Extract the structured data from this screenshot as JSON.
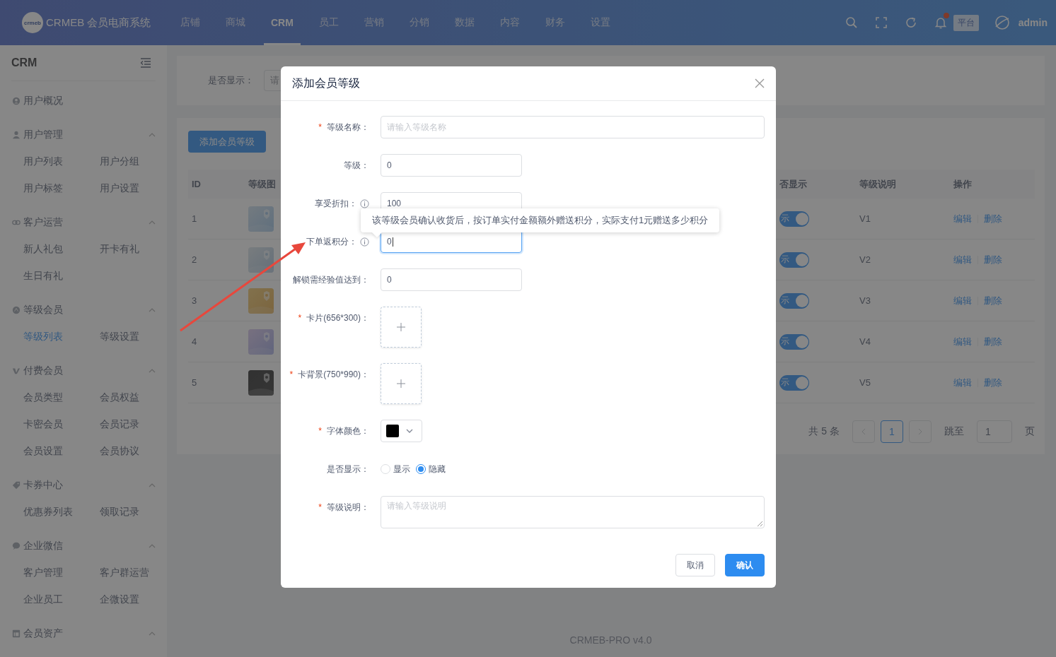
{
  "header": {
    "logo_text": "crmeb",
    "brand": "CRMEB 会员电商系统",
    "nav": [
      {
        "label": "店铺",
        "selected": false
      },
      {
        "label": "商城",
        "selected": false
      },
      {
        "label": "CRM",
        "selected": true
      },
      {
        "label": "员工",
        "selected": false
      },
      {
        "label": "营销",
        "selected": false
      },
      {
        "label": "分销",
        "selected": false
      },
      {
        "label": "数据",
        "selected": false
      },
      {
        "label": "内容",
        "selected": false
      },
      {
        "label": "财务",
        "selected": false
      },
      {
        "label": "设置",
        "selected": false
      }
    ],
    "notification_dot": true,
    "badge": "平台",
    "user": "admin"
  },
  "sidebar": {
    "title": "CRM",
    "groups": [
      {
        "label": "用户概况"
      },
      {
        "label": "用户管理",
        "expanded": true,
        "items": [
          {
            "label": "用户列表",
            "selected": false
          },
          {
            "label": "用户分组",
            "selected": false
          },
          {
            "label": "用户标签",
            "selected": false
          },
          {
            "label": "用户设置",
            "selected": false
          }
        ]
      },
      {
        "label": "客户运营",
        "expanded": true,
        "items": [
          {
            "label": "新人礼包",
            "selected": false
          },
          {
            "label": "开卡有礼",
            "selected": false
          },
          {
            "label": "生日有礼",
            "selected": false
          }
        ]
      },
      {
        "label": "等级会员",
        "expanded": true,
        "items": [
          {
            "label": "等级列表",
            "selected": true
          },
          {
            "label": "等级设置",
            "selected": false
          }
        ]
      },
      {
        "label": "付费会员",
        "expanded": true,
        "items": [
          {
            "label": "会员类型",
            "selected": false
          },
          {
            "label": "会员权益",
            "selected": false
          },
          {
            "label": "卡密会员",
            "selected": false
          },
          {
            "label": "会员记录",
            "selected": false
          },
          {
            "label": "会员设置",
            "selected": false
          },
          {
            "label": "会员协议",
            "selected": false
          }
        ]
      },
      {
        "label": "卡券中心",
        "expanded": true,
        "items": [
          {
            "label": "优惠券列表",
            "selected": false
          },
          {
            "label": "领取记录",
            "selected": false
          }
        ]
      },
      {
        "label": "企业微信",
        "expanded": true,
        "items": [
          {
            "label": "客户管理",
            "selected": false
          },
          {
            "label": "客户群运营",
            "selected": false
          },
          {
            "label": "企业员工",
            "selected": false
          },
          {
            "label": "企微设置",
            "selected": false
          }
        ]
      },
      {
        "label": "会员资产",
        "expanded": true
      }
    ]
  },
  "filter": {
    "label": "是否显示：",
    "placeholder": "请"
  },
  "table": {
    "add_button": "添加会员等级",
    "columns": [
      "ID",
      "等级图",
      "否显示",
      "等级说明",
      "操作"
    ],
    "rows": [
      {
        "id": "1",
        "shown": true,
        "toggle_text": "示",
        "description": "V1",
        "actions": [
          "编辑",
          "删除"
        ]
      },
      {
        "id": "2",
        "shown": true,
        "toggle_text": "示",
        "description": "V2",
        "actions": [
          "编辑",
          "删除"
        ]
      },
      {
        "id": "3",
        "shown": true,
        "toggle_text": "示",
        "description": "V3",
        "actions": [
          "编辑",
          "删除"
        ]
      },
      {
        "id": "4",
        "shown": true,
        "toggle_text": "示",
        "description": "V4",
        "actions": [
          "编辑",
          "删除"
        ]
      },
      {
        "id": "5",
        "shown": true,
        "toggle_text": "示",
        "description": "V5",
        "actions": [
          "编辑",
          "删除"
        ]
      }
    ]
  },
  "pagination": {
    "total": "共 5 条",
    "pages": [
      {
        "label": "1",
        "selected": true
      }
    ],
    "goto_label": "跳至",
    "goto_value": "1",
    "suffix": "页"
  },
  "footer": "CRMEB-PRO v4.0",
  "dialog": {
    "title": "添加会员等级",
    "fields": [
      {
        "kind": "text",
        "required_mark": "*",
        "label": "等级名称：",
        "placeholder": "请输入等级名称"
      },
      {
        "kind": "number",
        "label": "等级：",
        "value": "0"
      },
      {
        "kind": "number",
        "label": "享受折扣：",
        "info": true,
        "value": "100"
      },
      {
        "kind": "number",
        "label": "下单返积分：",
        "info": true,
        "focused": true,
        "value": "0"
      },
      {
        "kind": "number",
        "label": "解锁需经验值达到：",
        "value": "0"
      },
      {
        "kind": "upload",
        "required_mark": "*",
        "label": "卡片(656*300)："
      },
      {
        "kind": "upload",
        "required_mark": "*",
        "label": "卡背景(750*990)："
      },
      {
        "kind": "color",
        "required_mark": "*",
        "label": "字体颜色：",
        "color": "#000000"
      },
      {
        "kind": "radio",
        "label": "是否显示：",
        "options": [
          {
            "label": "显示",
            "selected": false
          },
          {
            "label": "隐藏",
            "selected": true
          }
        ]
      },
      {
        "kind": "textarea",
        "required_mark": "*",
        "label": "等级说明：",
        "placeholder": "请输入等级说明"
      }
    ],
    "tooltip": "该等级会员确认收货后，按订单实付金额额外赠送积分，实际支付1元赠送多少积分",
    "buttons": [
      {
        "label": "取消",
        "kind": "default"
      },
      {
        "label": "确认",
        "kind": "primary"
      }
    ]
  }
}
